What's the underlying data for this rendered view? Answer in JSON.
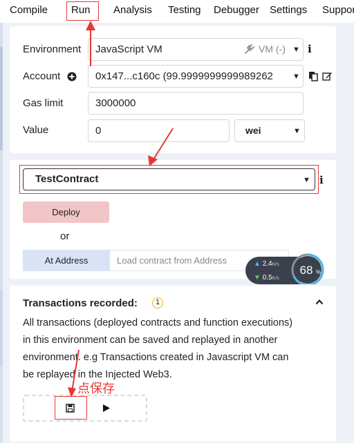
{
  "tabs": [
    "Compile",
    "Run",
    "Analysis",
    "Testing",
    "Debugger",
    "Settings",
    "Suppor"
  ],
  "environment": {
    "label": "Environment",
    "value": "JavaScript VM",
    "badge": "VM (-)"
  },
  "account": {
    "label": "Account",
    "value": "0x147...c160c (99.9999999999989262"
  },
  "gas_limit": {
    "label": "Gas limit",
    "value": "3000000"
  },
  "value_field": {
    "label": "Value",
    "value": "0",
    "unit": "wei"
  },
  "contract": {
    "selected": "TestContract"
  },
  "deploy": {
    "label": "Deploy",
    "or": "or"
  },
  "at_address": {
    "label": "At Address",
    "placeholder": "Load contract from Address"
  },
  "network_widget": {
    "up": "2.4",
    "down": "0.5",
    "unit": "K/s",
    "percent": "68",
    "percent_sign": "%"
  },
  "transactions": {
    "title": "Transactions recorded:",
    "count": "1",
    "description_lines": [
      "All transactions (deployed contracts and function executions)",
      "in this environment can be saved and replayed in another",
      "environment. e.g Transactions created in Javascript VM can",
      "be replayed in the Injected Web3."
    ]
  },
  "annotation": {
    "text": "点保存"
  },
  "colors": {
    "annotation_red": "#e53935",
    "deploy_bg": "#f2c5c8",
    "at_address_bg": "#d9e3f5"
  }
}
